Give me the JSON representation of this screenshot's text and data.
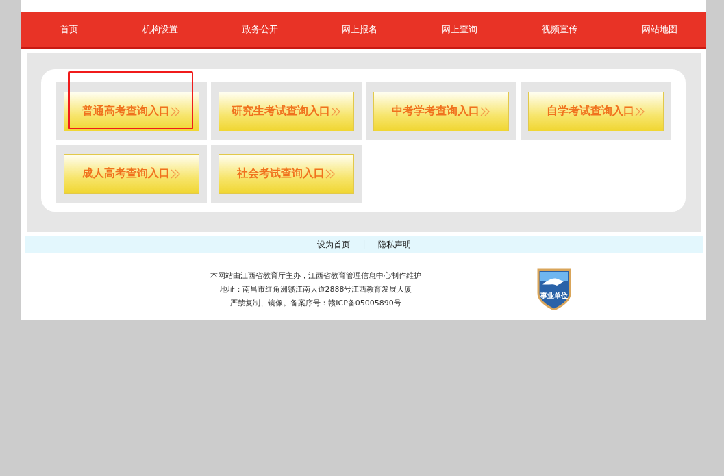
{
  "nav": [
    {
      "label": "首页"
    },
    {
      "label": "机构设置"
    },
    {
      "label": "政务公开"
    },
    {
      "label": "网上报名"
    },
    {
      "label": "网上查询"
    },
    {
      "label": "视频宣传"
    },
    {
      "label": "网站地图"
    }
  ],
  "entries": [
    {
      "label": "普通高考查询入口",
      "selected": true
    },
    {
      "label": "研究生考试查询入口",
      "selected": false
    },
    {
      "label": "中考学考查询入口",
      "selected": false
    },
    {
      "label": "自学考试查询入口",
      "selected": false
    },
    {
      "label": "成人高考查询入口",
      "selected": false
    },
    {
      "label": "社会考试查询入口",
      "selected": false
    }
  ],
  "footer_links": [
    "设为首页",
    "隐私声明"
  ],
  "footer_separator": "|",
  "footer_lines": [
    "本网站由江西省教育厅主办，江西省教育管理信息中心制作维护",
    "地址：南昌市红角洲赣江南大道2888号江西教育发展大厦",
    "严禁复制、镜像。备案序号：赣ICP备05005890号"
  ],
  "badge": {
    "label": "事业单位"
  }
}
